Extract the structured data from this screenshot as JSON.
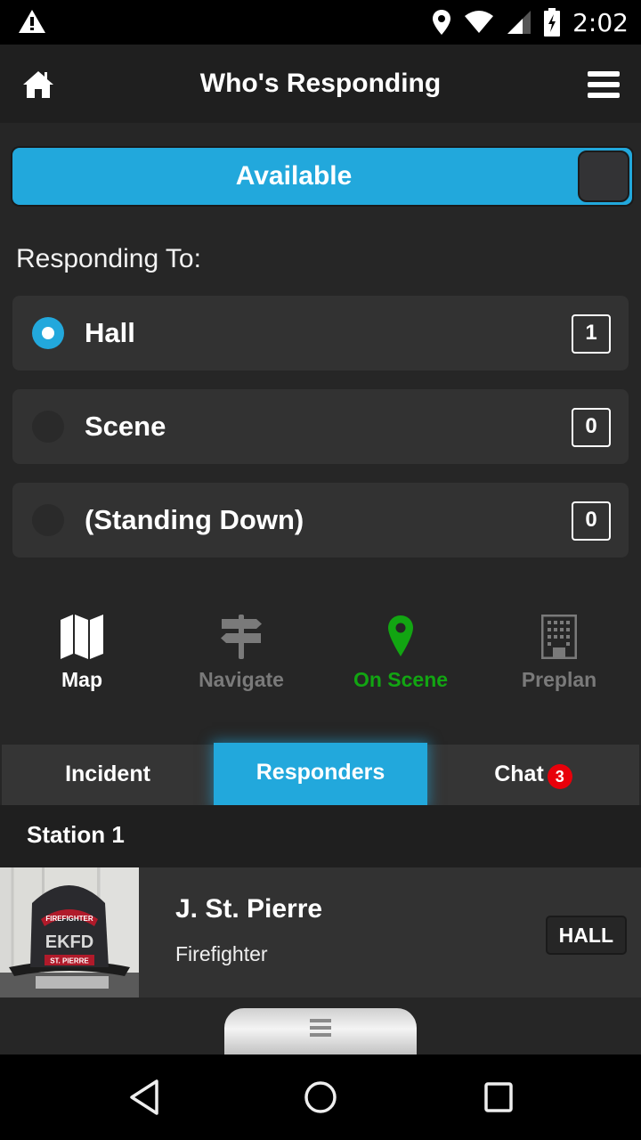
{
  "status_bar": {
    "time": "2:02",
    "icons": [
      "warning-icon",
      "location-icon",
      "wifi-icon",
      "cell-signal-icon",
      "battery-charging-icon"
    ]
  },
  "app_bar": {
    "title": "Who's Responding",
    "left_icon": "home-icon",
    "right_icon": "hamburger-menu-icon"
  },
  "availability": {
    "label": "Available",
    "on": true,
    "color": "#22a8dc"
  },
  "responding_to": {
    "label": "Responding To:",
    "options": [
      {
        "label": "Hall",
        "count": "1",
        "selected": true
      },
      {
        "label": "Scene",
        "count": "0",
        "selected": false
      },
      {
        "label": "(Standing Down)",
        "count": "0",
        "selected": false
      }
    ]
  },
  "actions": [
    {
      "label": "Map",
      "icon": "map-icon",
      "color": "#ffffff"
    },
    {
      "label": "Navigate",
      "icon": "signpost-icon",
      "color": "#7a7a7a"
    },
    {
      "label": "On Scene",
      "icon": "map-pin-icon",
      "color": "#12a512"
    },
    {
      "label": "Preplan",
      "icon": "building-icon",
      "color": "#7a7a7a"
    }
  ],
  "tabs": [
    {
      "label": "Incident",
      "active": false
    },
    {
      "label": "Responders",
      "active": true
    },
    {
      "label": "Chat",
      "active": false,
      "badge": "3"
    }
  ],
  "responders": {
    "group": "Station 1",
    "items": [
      {
        "name": "J. St. Pierre",
        "role": "Firefighter",
        "status": "HALL",
        "avatar_text": {
          "top": "FIREFIGHTER",
          "center": "EKFD",
          "bottom": "ST. PIERRE"
        }
      }
    ]
  },
  "drawer_handle_icon": "drag-handle-icon",
  "nav_bar": {
    "buttons": [
      "back-icon",
      "home-circle-icon",
      "recents-icon"
    ]
  }
}
